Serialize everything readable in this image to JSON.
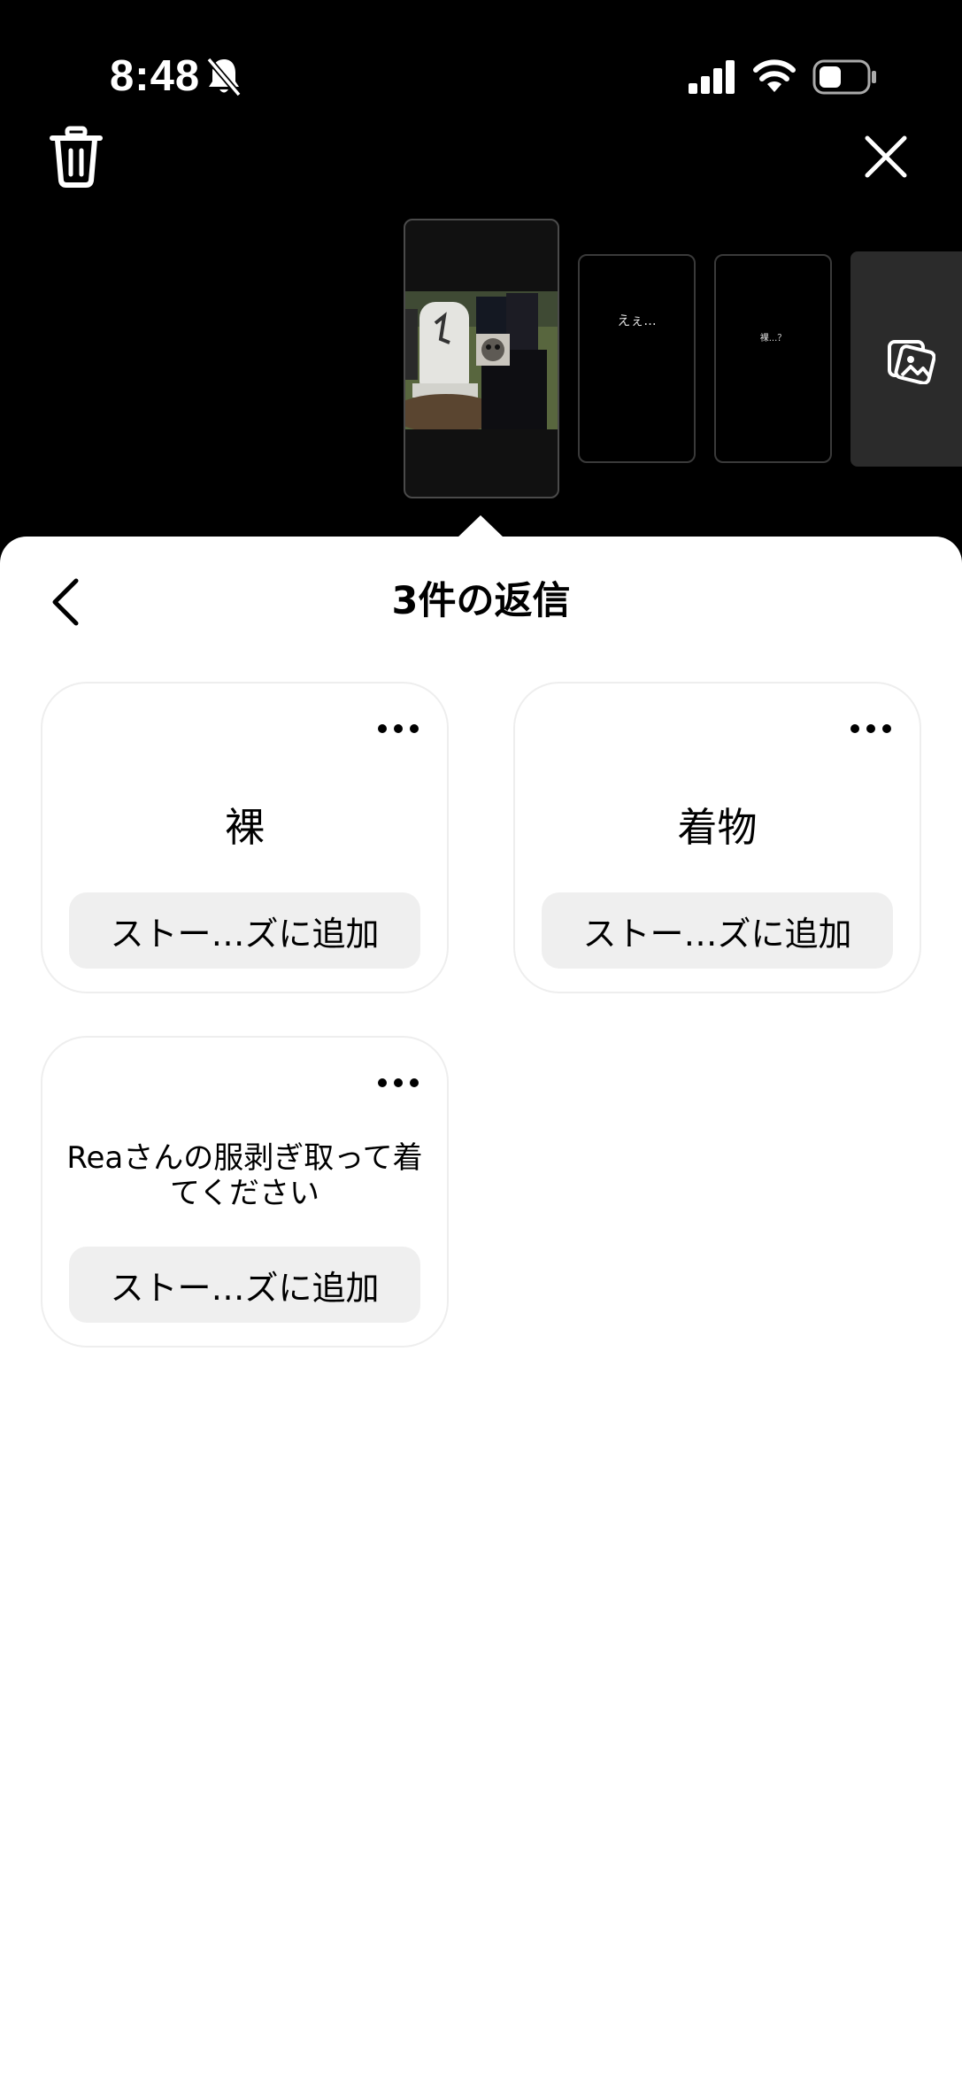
{
  "status_bar": {
    "time": "8:48"
  },
  "thumbnails": [
    {
      "text": ""
    },
    {
      "text": "えぇ..."
    },
    {
      "text": "裸...？"
    }
  ],
  "sheet": {
    "title": "3件の返信",
    "replies": [
      {
        "text": "裸",
        "button_label": "ストー…ズに追加"
      },
      {
        "text": "着物",
        "button_label": "ストー…ズに追加"
      },
      {
        "text": "Reaさんの服剥ぎ取って着てください",
        "button_label": "ストー…ズに追加"
      }
    ]
  }
}
